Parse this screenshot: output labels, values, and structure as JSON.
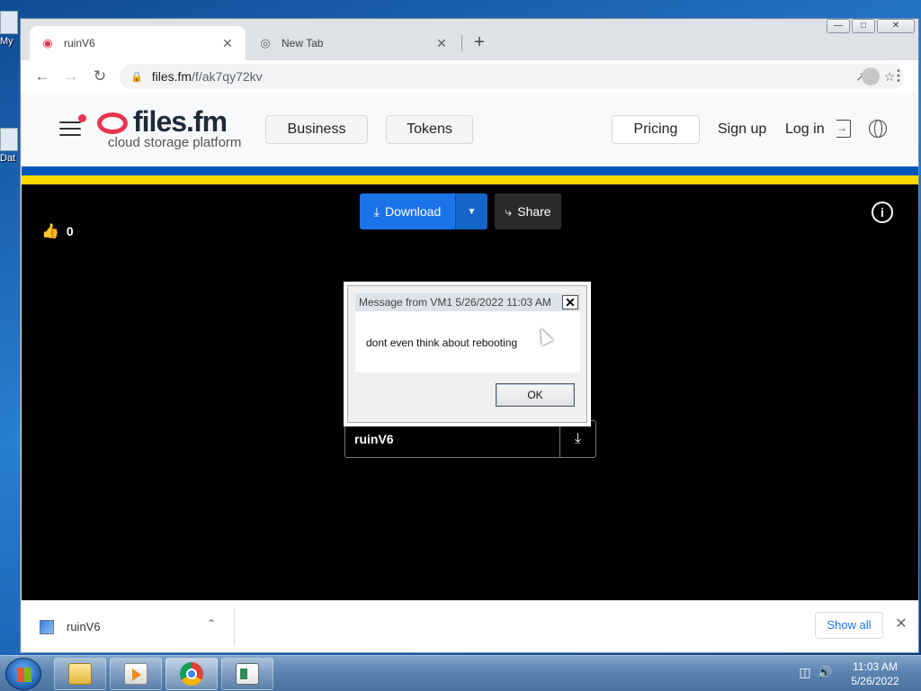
{
  "desktop": {
    "icon_labels": [
      "My",
      "Dat"
    ]
  },
  "browser": {
    "tabs": [
      {
        "title": "ruinV6",
        "active": true,
        "icon": "files-fm-favicon-icon"
      },
      {
        "title": "New Tab",
        "active": false,
        "icon": "chrome-icon"
      }
    ],
    "new_tab_symbol": "+",
    "close_tab_symbol": "✕",
    "url_host": "files.fm",
    "url_path": "/f/ak7qy72kv"
  },
  "site": {
    "logo_name": "files.fm",
    "logo_tagline": "cloud storage platform",
    "nav": {
      "business": "Business",
      "tokens": "Tokens",
      "pricing": "Pricing",
      "signup": "Sign up",
      "login": "Log in"
    },
    "like_count": "0",
    "download_label": "Download",
    "share_label": "Share",
    "file_name": "ruinV6",
    "accent_color": "#1a73e8",
    "brand_color": "#e8344e"
  },
  "message_box": {
    "title": "Message from VM1 5/26/2022 11:03 AM",
    "body": "dont even think about rebooting",
    "ok_label": "OK",
    "close_symbol": "✕"
  },
  "download_shelf": {
    "item_name": "ruinV6",
    "show_all_label": "Show all",
    "close_symbol": "✕"
  },
  "taskbar": {
    "time": "11:03 AM",
    "date": "5/26/2022",
    "pinned": [
      "folder-icon",
      "media-player-icon",
      "chrome-icon",
      "app-window-icon"
    ]
  }
}
